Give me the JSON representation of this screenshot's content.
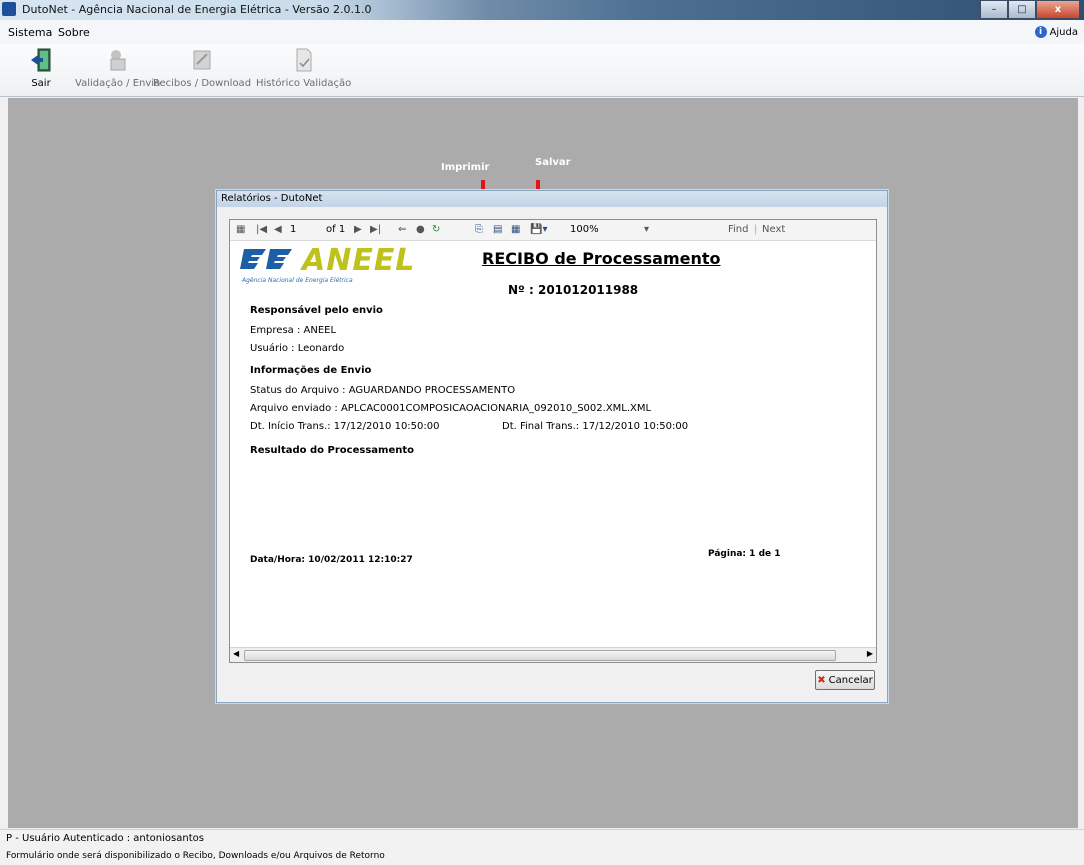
{
  "window": {
    "title": "DutoNet - Agência Nacional de Energia Elétrica - Versão 2.0.1.0"
  },
  "menu": {
    "items": [
      "Sistema",
      "Sobre"
    ],
    "help_label": "Ajuda"
  },
  "toolbar": {
    "buttons": [
      {
        "label": "Sair",
        "icon": "exit-door-icon",
        "enabled": true
      },
      {
        "label": "Validação / Envio",
        "icon": "validate-send-icon",
        "enabled": false
      },
      {
        "label": "Recibos / Download",
        "icon": "receipts-download-icon",
        "enabled": false
      },
      {
        "label": "Histórico Validação",
        "icon": "history-validation-icon",
        "enabled": false
      }
    ]
  },
  "annotations": {
    "print": "Imprimir",
    "save": "Salvar",
    "arrow_color": "#e8101a"
  },
  "dialog": {
    "title": "Relatórios - DutoNet",
    "cancel_label": "Cancelar"
  },
  "viewer_toolbar": {
    "page_current": "1",
    "page_total": "of 1",
    "zoom": "100%",
    "find_label": "Find",
    "next_label": "Next"
  },
  "report": {
    "logo_text": "ANEEL",
    "logo_subtitle": "Agência Nacional de Energia Elétrica",
    "title": "RECIBO de Processamento",
    "number": "Nº : 201012011988",
    "sender_heading": "Responsável pelo envio",
    "company": "Empresa : ANEEL",
    "user": "Usuário : Leonardo",
    "info_heading": "Informações de Envio",
    "file_status": "Status do Arquivo : AGUARDANDO PROCESSAMENTO",
    "file_sent": "Arquivo enviado  : APLCAC0001COMPOSICAOACIONARIA_092010_S002.XML.XML",
    "start_date": "Dt. Início Trans.: 17/12/2010 10:50:00",
    "end_date": "Dt. Final Trans.: 17/12/2010 10:50:00",
    "result_heading": "Resultado do Processamento",
    "datetime": "Data/Hora: 10/02/2011 12:10:27",
    "page": "Página: 1 de 1"
  },
  "status": {
    "line1": "P - Usuário Autenticado : antoniosantos",
    "line2": "Formulário onde será disponibilizado o Recibo, Downloads  e/ou Arquivos de Retorno"
  }
}
